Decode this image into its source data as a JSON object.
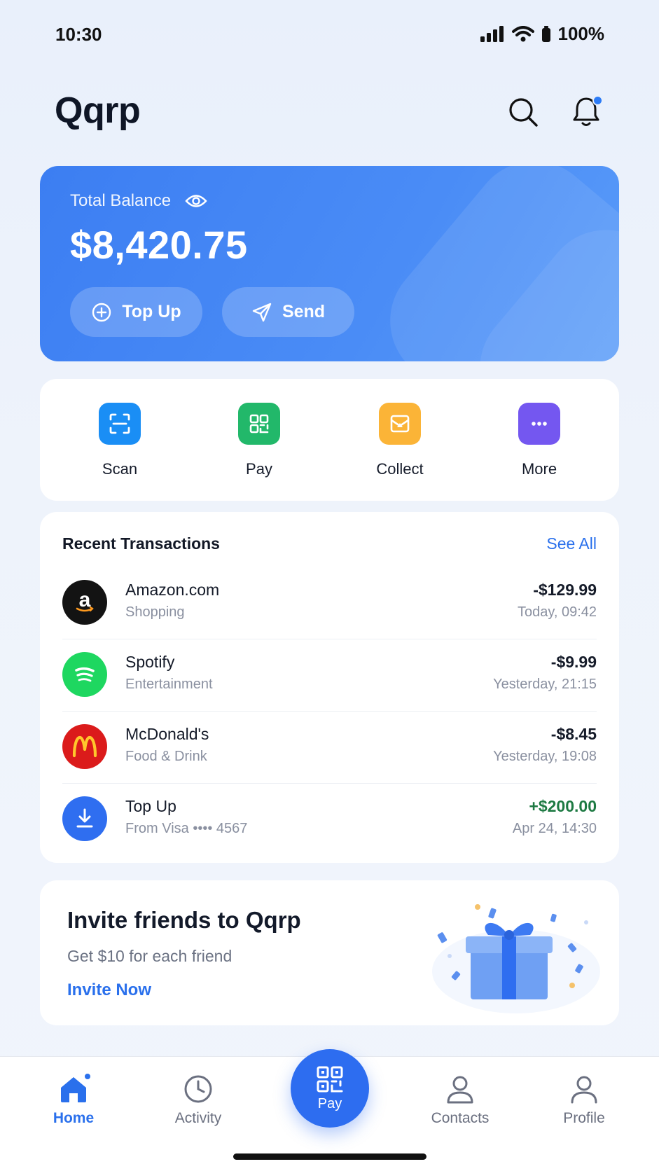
{
  "status_bar": {
    "time": "10:30",
    "battery": "100%"
  },
  "header": {
    "title": "Qqrp"
  },
  "balance": {
    "label": "Total Balance",
    "amount": "$8,420.75",
    "top_up_label": "Top Up",
    "send_label": "Send"
  },
  "quick_actions": [
    {
      "label": "Scan",
      "color": "#1a8ef5",
      "icon": "scan-icon"
    },
    {
      "label": "Pay",
      "color": "#22b86a",
      "icon": "qr-pay-icon"
    },
    {
      "label": "Collect",
      "color": "#fbb437",
      "icon": "collect-icon"
    },
    {
      "label": "More",
      "color": "#7457f0",
      "icon": "more-dots-icon"
    }
  ],
  "transactions": {
    "title": "Recent Transactions",
    "see_all": "See All",
    "items": [
      {
        "name": "Amazon.com",
        "category": "Shopping",
        "amount": "-$129.99",
        "time": "Today, 09:42",
        "logo": "amazon-logo"
      },
      {
        "name": "Spotify",
        "category": "Entertainment",
        "amount": "-$9.99",
        "time": "Yesterday, 21:15",
        "logo": "spotify-logo"
      },
      {
        "name": "McDonald's",
        "category": "Food & Drink",
        "amount": "-$8.45",
        "time": "Yesterday, 19:08",
        "logo": "mcdonalds-logo"
      },
      {
        "name": "Top Up",
        "category": "From Visa •••• 4567",
        "amount": "+$200.00",
        "time": "Apr 24, 14:30",
        "logo": "download-icon"
      }
    ]
  },
  "invite": {
    "title": "Invite friends to Qqrp",
    "subtitle": "Get $10 for each friend",
    "cta": "Invite Now"
  },
  "nav": {
    "home": "Home",
    "activity": "Activity",
    "pay": "Pay",
    "contacts": "Contacts",
    "profile": "Profile"
  },
  "colors": {
    "accent": "#2d6df0",
    "positive": "#1e7a43"
  }
}
